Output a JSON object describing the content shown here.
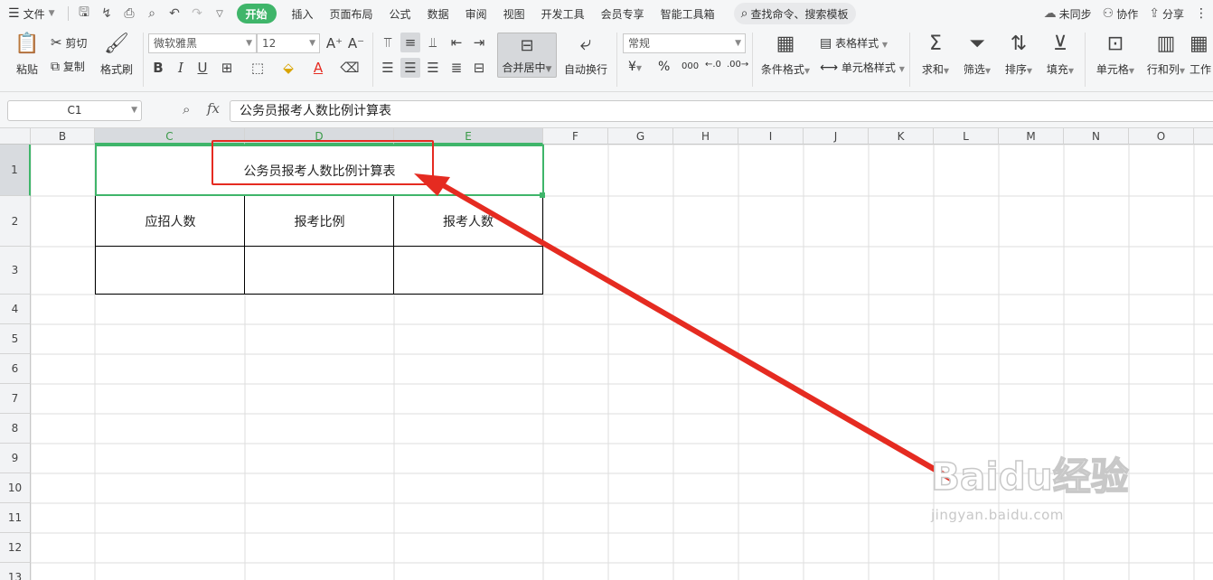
{
  "menubar": {
    "file": "文件",
    "tabs": [
      "开始",
      "插入",
      "页面布局",
      "公式",
      "数据",
      "审阅",
      "视图",
      "开发工具",
      "会员专享",
      "智能工具箱"
    ],
    "search": "查找命令、搜索模板",
    "sync": "未同步",
    "collab": "协作",
    "share": "分享"
  },
  "ribbon": {
    "paste": "粘贴",
    "cut": "剪切",
    "copy": "复制",
    "format_painter": "格式刷",
    "font_name": "微软雅黑",
    "font_size": "12",
    "merge_center": "合并居中",
    "auto_wrap": "自动换行",
    "number_format": "常规",
    "conditional_format": "条件格式",
    "table_style": "表格样式",
    "cell_style": "单元格样式",
    "sum": "求和",
    "filter": "筛选",
    "sort": "排序",
    "fill": "填充",
    "cell": "单元格",
    "row_col": "行和列",
    "worksheet": "工作",
    "percent": "%",
    "thousands": "000",
    "currency": "¥"
  },
  "formula_bar": {
    "cell_ref": "C1",
    "fx": "fx",
    "content": "公务员报考人数比例计算表"
  },
  "sheet": {
    "columns": [
      "B",
      "C",
      "D",
      "E",
      "F",
      "G",
      "H",
      "I",
      "J",
      "K",
      "L",
      "M",
      "N",
      "O"
    ],
    "rows": [
      "1",
      "2",
      "3",
      "4",
      "5",
      "6",
      "7",
      "8",
      "9",
      "10",
      "11",
      "12",
      "13"
    ],
    "title": "公务员报考人数比例计算表",
    "headers": [
      "应招人数",
      "报考比例",
      "报考人数"
    ]
  },
  "watermark": {
    "brand": "Baidu经验",
    "url": "jingyan.baidu.com"
  },
  "colors": {
    "accent_green": "#3fb56a",
    "annotation_red": "#e52b21"
  }
}
